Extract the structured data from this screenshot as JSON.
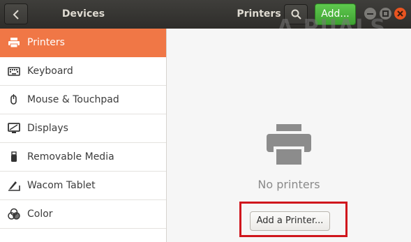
{
  "header": {
    "panel_title": "Devices",
    "page_title": "Printers",
    "add_label": "Add..."
  },
  "watermark": "A PUALS",
  "sidebar": {
    "items": [
      {
        "label": "Printers",
        "icon": "printer-icon",
        "active": true
      },
      {
        "label": "Keyboard",
        "icon": "keyboard-icon"
      },
      {
        "label": "Mouse & Touchpad",
        "icon": "mouse-icon"
      },
      {
        "label": "Displays",
        "icon": "display-icon"
      },
      {
        "label": "Removable Media",
        "icon": "usb-icon"
      },
      {
        "label": "Wacom Tablet",
        "icon": "tablet-icon"
      },
      {
        "label": "Color",
        "icon": "color-icon"
      }
    ]
  },
  "main": {
    "empty_text": "No printers",
    "add_printer_label": "Add a Printer..."
  },
  "colors": {
    "accent": "#f07746",
    "add_button": "#4cb43e",
    "highlight_box": "#d0161d",
    "headerbar": "#363532"
  }
}
